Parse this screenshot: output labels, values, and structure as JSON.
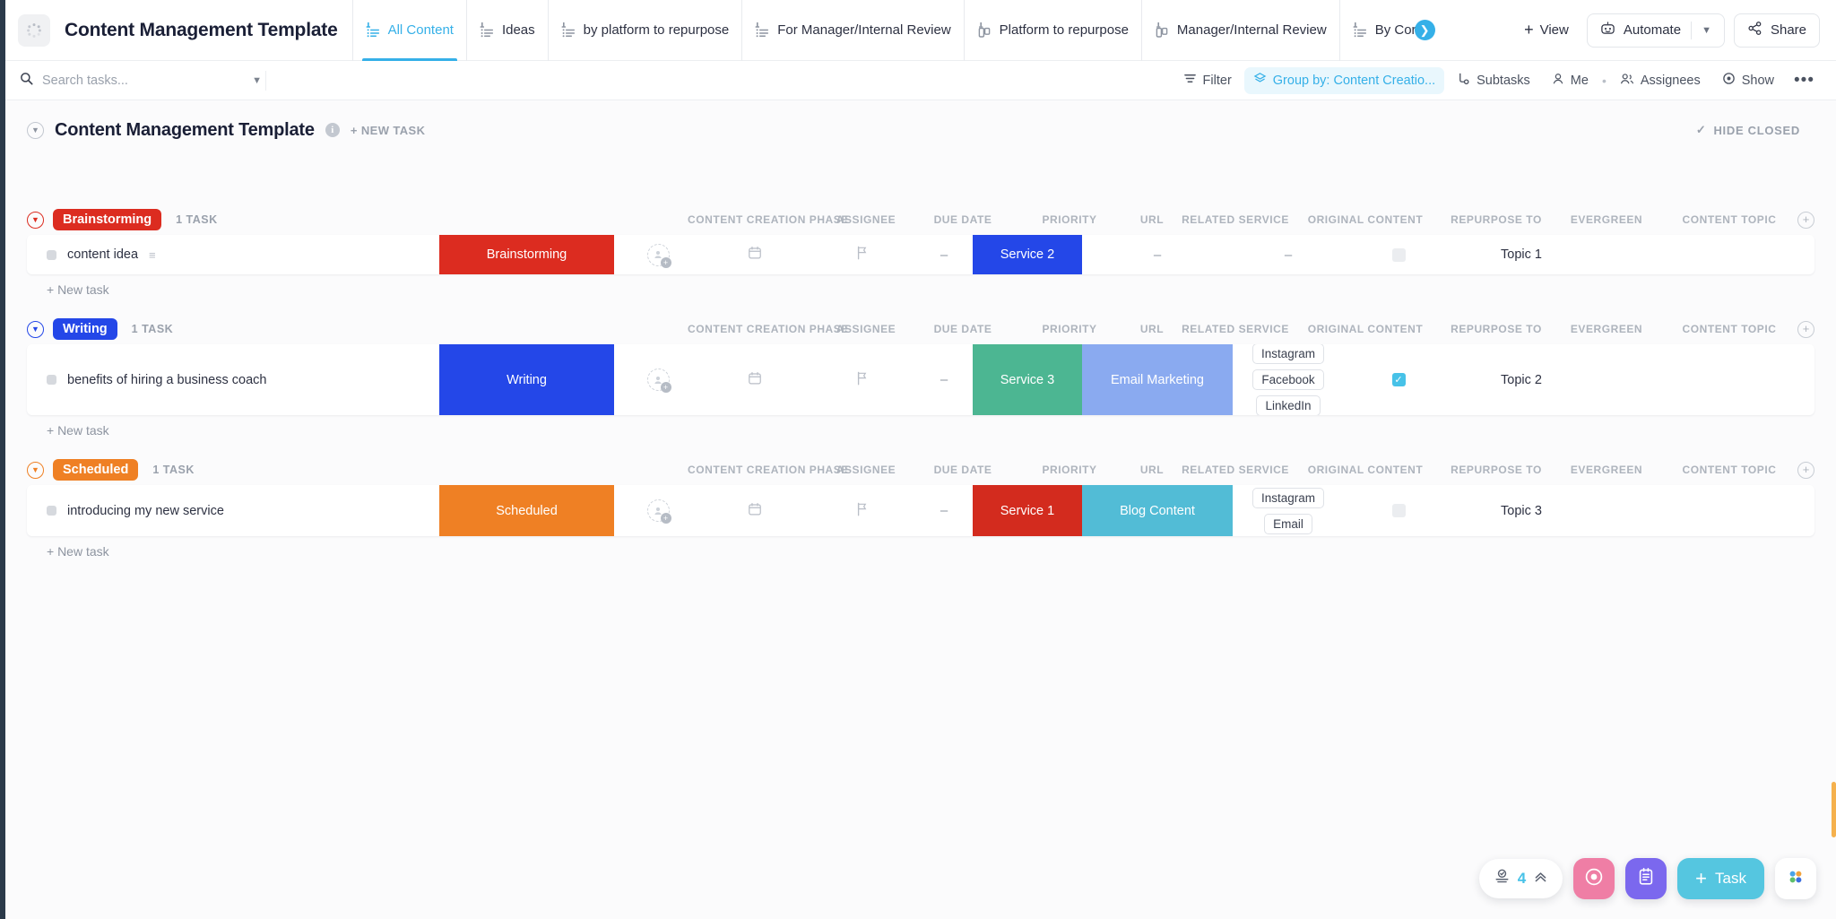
{
  "header": {
    "workspace_title": "Content Management Template",
    "app_icon": "clickup-logo-icon",
    "tabs": [
      {
        "label": "All Content",
        "icon": "list-view-icon",
        "active": true,
        "pinned": true
      },
      {
        "label": "Ideas",
        "icon": "list-view-icon",
        "active": false,
        "pinned": true
      },
      {
        "label": "by platform to repurpose",
        "icon": "list-view-icon",
        "active": false,
        "pinned": true
      },
      {
        "label": "For Manager/Internal Review",
        "icon": "list-view-icon",
        "active": false,
        "pinned": true
      },
      {
        "label": "Platform to repurpose",
        "icon": "board-view-icon",
        "active": false,
        "pinned": true
      },
      {
        "label": "Manager/Internal Review",
        "icon": "board-view-icon",
        "active": false,
        "pinned": true
      },
      {
        "label": "By Cor",
        "icon": "list-view-icon",
        "active": false,
        "pinned": true
      }
    ],
    "add_view_label": "View",
    "automate_label": "Automate",
    "share_label": "Share",
    "accent_color": "#35b0e8"
  },
  "toolbar": {
    "search_placeholder": "Search tasks...",
    "search_value": "",
    "filter_label": "Filter",
    "group_by_label": "Group by: Content Creatio...",
    "subtasks_label": "Subtasks",
    "me_label": "Me",
    "assignees_label": "Assignees",
    "show_label": "Show",
    "more_label": "•••"
  },
  "list_header": {
    "title": "Content Management Template",
    "new_task_label": "+ NEW TASK",
    "hide_closed_label": "HIDE CLOSED"
  },
  "columns": [
    {
      "key": "phase",
      "label": "CONTENT CREATION PHASE"
    },
    {
      "key": "assignee",
      "label": "ASSIGNEE"
    },
    {
      "key": "due",
      "label": "DUE DATE"
    },
    {
      "key": "priority",
      "label": "PRIORITY"
    },
    {
      "key": "url",
      "label": "URL"
    },
    {
      "key": "service",
      "label": "RELATED SERVICE"
    },
    {
      "key": "original",
      "label": "ORIGINAL CONTENT"
    },
    {
      "key": "repurpose",
      "label": "REPURPOSE TO"
    },
    {
      "key": "evergreen",
      "label": "EVERGREEN"
    },
    {
      "key": "topic",
      "label": "CONTENT TOPIC"
    }
  ],
  "groups": [
    {
      "name": "Brainstorming",
      "color": "#dc2c20",
      "count_label": "1 TASK",
      "new_task_label": "+ New task",
      "tasks": [
        {
          "name": "content idea",
          "phase": "Brainstorming",
          "phase_color": "#dc2c20",
          "assignee": "",
          "due": "",
          "priority": "",
          "url": "–",
          "service": "Service 2",
          "service_color": "#2447e8",
          "original": "–",
          "original_color": "",
          "repurpose": [],
          "repurpose_placeholder": "–",
          "evergreen": false,
          "topic": "Topic 1"
        }
      ]
    },
    {
      "name": "Writing",
      "color": "#2447e8",
      "count_label": "1 TASK",
      "new_task_label": "+ New task",
      "tasks": [
        {
          "name": "benefits of hiring a business coach",
          "phase": "Writing",
          "phase_color": "#2447e8",
          "assignee": "",
          "due": "",
          "priority": "",
          "url": "–",
          "service": "Service 3",
          "service_color": "#4cb692",
          "original": "Email Marketing",
          "original_color": "#8aaaf0",
          "repurpose": [
            "Instagram",
            "Facebook",
            "LinkedIn"
          ],
          "repurpose_placeholder": "",
          "evergreen": true,
          "topic": "Topic 2"
        }
      ]
    },
    {
      "name": "Scheduled",
      "color": "#ef8024",
      "count_label": "1 TASK",
      "new_task_label": "+ New task",
      "tasks": [
        {
          "name": "introducing my new service",
          "phase": "Scheduled",
          "phase_color": "#ef8024",
          "assignee": "",
          "due": "",
          "priority": "",
          "url": "–",
          "service": "Service 1",
          "service_color": "#d32b1e",
          "original": "Blog Content",
          "original_color": "#52bcd6",
          "repurpose": [
            "Instagram",
            "Email"
          ],
          "repurpose_placeholder": "",
          "evergreen": false,
          "topic": "Topic 3"
        }
      ]
    }
  ],
  "fab": {
    "count": "4",
    "count_icon": "tray-icon",
    "expand_icon": "chevron-double-up-icon",
    "record_icon": "record-circle-icon",
    "notepad_icon": "notepad-icon",
    "task_label": "Task",
    "apps_icon": "apps-grid-icon",
    "colors": {
      "record": "#ef7ea5",
      "notepad": "#7b68ee",
      "task": "#55c6e0"
    }
  }
}
